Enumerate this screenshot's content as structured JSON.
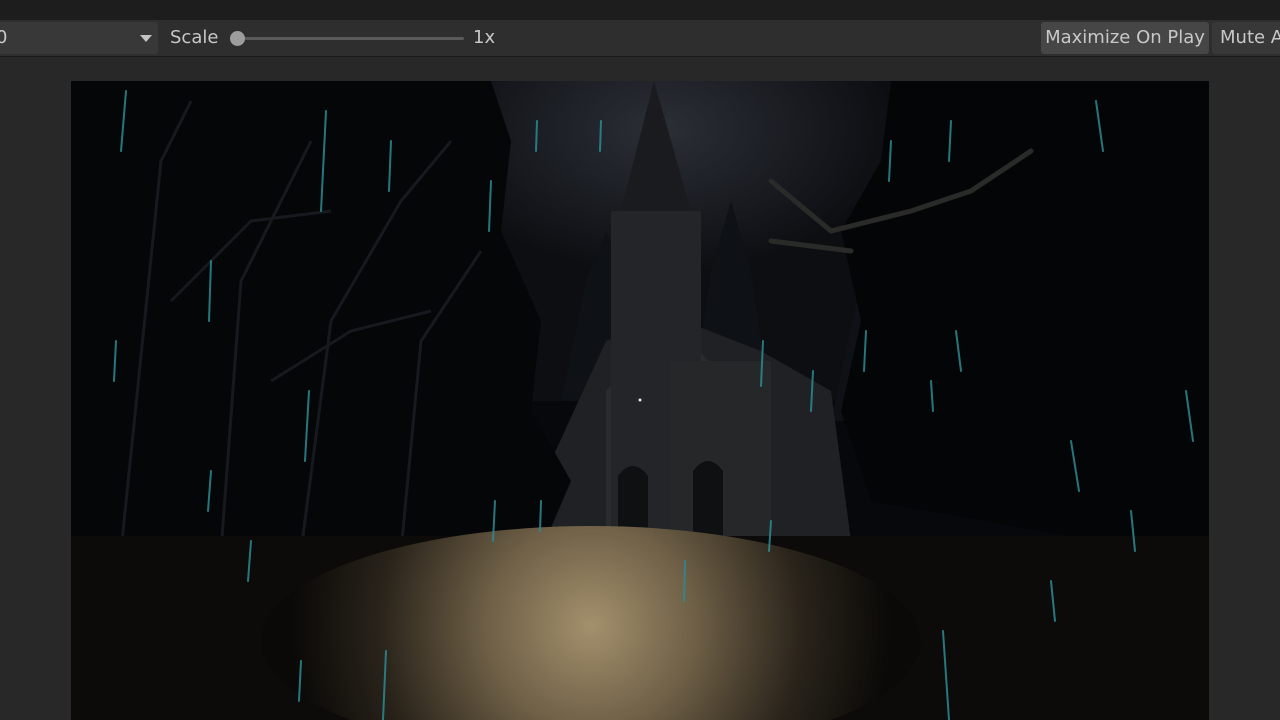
{
  "toolbar": {
    "display_value": "0",
    "scale_label": "Scale",
    "scale_value": "1x",
    "scale_level": 0,
    "maximize_label": "Maximize On Play",
    "mute_label": "Mute A"
  },
  "icons": {
    "dropdown_caret": "chevron-down-icon"
  }
}
